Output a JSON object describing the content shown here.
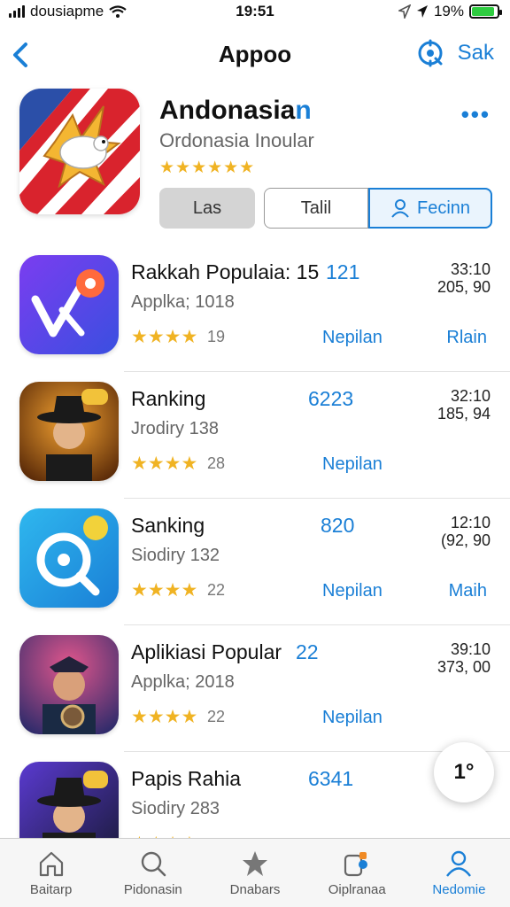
{
  "status_bar": {
    "carrier": "dousiapme",
    "time": "19:51",
    "battery_percent": "19%",
    "battery_level": 0.9
  },
  "nav": {
    "title": "Appoo",
    "right_label": "Sak"
  },
  "header": {
    "title_prefix": "Andonasia",
    "title_accent": "n",
    "subtitle": "Ordonasia Inoular",
    "stars": "★★★★★★",
    "more": "•••",
    "segments": [
      "Las",
      "Talil",
      "Fecinn"
    ]
  },
  "list": [
    {
      "title": "Rakkah Populaia: 15",
      "count": "121",
      "sub": "Applka; 1018",
      "stars": "★★★★",
      "rating": "19",
      "action": "Nepilan",
      "action2": "Rlain",
      "time1": "33:10",
      "time2": "205, 90"
    },
    {
      "title": "Ranking",
      "count": "6223",
      "sub": "Jrodiry 138",
      "stars": "★★★★",
      "rating": "28",
      "action": "Nepilan",
      "action2": "",
      "time1": "32:10",
      "time2": "185, 94"
    },
    {
      "title": "Sanking",
      "count": "820",
      "sub": "Siodiry 132",
      "stars": "★★★★",
      "rating": "22",
      "action": "Nepilan",
      "action2": "Maih",
      "time1": "12:10",
      "time2": "(92, 90"
    },
    {
      "title": "Aplikiasi Popular",
      "count": "22",
      "sub": "Applka; 2018",
      "stars": "★★★★",
      "rating": "22",
      "action": "Nepilan",
      "action2": "",
      "time1": "39:10",
      "time2": "373, 00"
    },
    {
      "title": "Papis Rahia",
      "count": "6341",
      "sub": "Siodiry 283",
      "stars": "★★★★",
      "rating": "",
      "action": "",
      "action2": "",
      "time1": "",
      "time2": ""
    }
  ],
  "fab": {
    "label": "1°"
  },
  "tabs": [
    {
      "label": "Baitarp",
      "icon": "home-icon"
    },
    {
      "label": "Pidonasin",
      "icon": "search-icon"
    },
    {
      "label": "Dnabars",
      "icon": "star-icon"
    },
    {
      "label": "Oiplranaa",
      "icon": "apps-icon"
    },
    {
      "label": "Nedomie",
      "icon": "person-icon"
    }
  ]
}
